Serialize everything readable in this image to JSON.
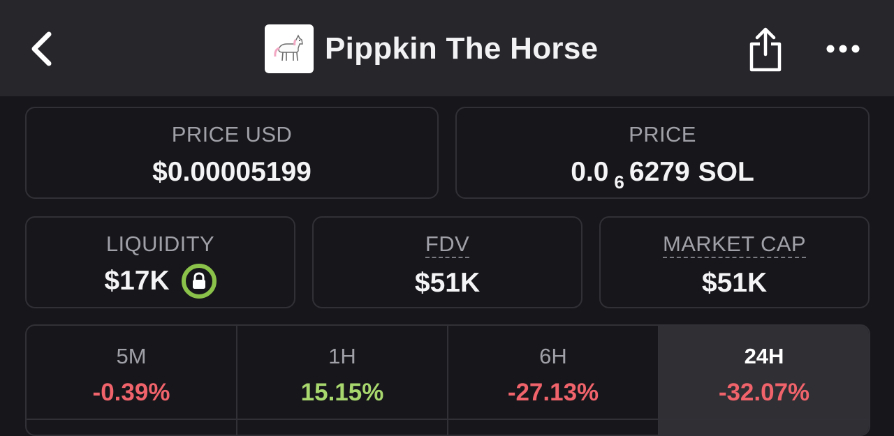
{
  "header": {
    "token_name": "Pippkin The Horse",
    "icons": {
      "back": "chevron-left-icon",
      "logo": "horse-logo-icon",
      "share": "share-icon",
      "more": "more-horizontal-icon"
    }
  },
  "price_usd": {
    "label": "PRICE USD",
    "value": "$0.00005199"
  },
  "price_native": {
    "label": "PRICE",
    "value_prefix": "0.0",
    "zero_count": "6",
    "value_digits": "6279",
    "unit": "SOL"
  },
  "liquidity": {
    "label": "LIQUIDITY",
    "value": "$17K",
    "icon": "lock-icon"
  },
  "fdv": {
    "label": "FDV",
    "value": "$51K"
  },
  "market_cap": {
    "label": "MARKET CAP",
    "value": "$51K"
  },
  "timeframes": [
    {
      "label": "5M",
      "change": "-0.39%",
      "trend": "negative"
    },
    {
      "label": "1H",
      "change": "15.15%",
      "trend": "positive"
    },
    {
      "label": "6H",
      "change": "-27.13%",
      "trend": "negative"
    },
    {
      "label": "24H",
      "change": "-32.07%",
      "trend": "negative",
      "selected": true
    }
  ],
  "colors": {
    "background": "#17171b",
    "header": "#26262b",
    "negative": "#f0636b",
    "positive": "#a8d76e",
    "lock_ring": "#8bc34a"
  }
}
